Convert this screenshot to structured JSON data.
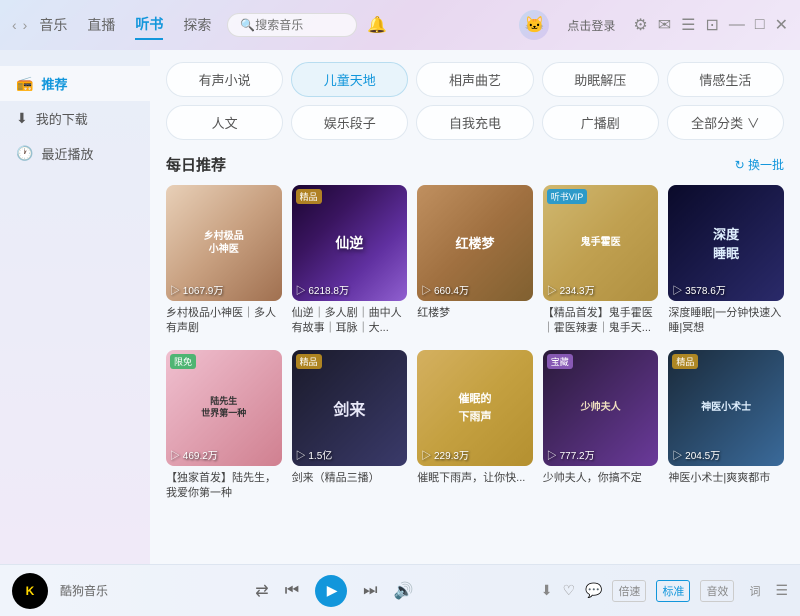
{
  "titleBar": {
    "navArrows": [
      "‹",
      "›"
    ],
    "navItems": [
      {
        "label": "音乐",
        "active": false
      },
      {
        "label": "直播",
        "active": false
      },
      {
        "label": "听书",
        "active": true
      },
      {
        "label": "探索",
        "active": false
      }
    ],
    "searchPlaceholder": "搜索音乐",
    "loginLabel": "点击登录",
    "windowControls": [
      "⚙",
      "✉",
      "☰",
      "⊡",
      "—",
      "□",
      "✕"
    ]
  },
  "sidebar": {
    "items": [
      {
        "label": "推荐",
        "icon": "📻",
        "active": true
      },
      {
        "label": "我的下载",
        "icon": "⬇",
        "active": false
      },
      {
        "label": "最近播放",
        "icon": "🕐",
        "active": false
      }
    ]
  },
  "categories": {
    "row1": [
      {
        "label": "有声小说",
        "active": false
      },
      {
        "label": "儿童天地",
        "active": true
      },
      {
        "label": "相声曲艺",
        "active": false
      },
      {
        "label": "助眠解压",
        "active": false
      },
      {
        "label": "情感生活",
        "active": false
      }
    ],
    "row2": [
      {
        "label": "人文",
        "active": false
      },
      {
        "label": "娱乐段子",
        "active": false
      },
      {
        "label": "自我充电",
        "active": false
      },
      {
        "label": "广播剧",
        "active": false
      },
      {
        "label": "全部分类 ∨",
        "active": false
      }
    ]
  },
  "dailySection": {
    "title": "每日推荐",
    "refreshLabel": "↻ 换一批"
  },
  "cards": {
    "row1": [
      {
        "badge": "",
        "badgeType": "",
        "playCount": "▷ 1067.9万",
        "title": "乡村极品小神医｜多人有声剧",
        "bg": "bg1",
        "overlayText": "乡村极品小神医"
      },
      {
        "badge": "精品",
        "badgeType": "gold",
        "playCount": "▷ 6218.8万",
        "title": "仙逆｜多人剧｜曲中人有故事｜耳脉｜大...",
        "bg": "bg2",
        "overlayText": "仙逆"
      },
      {
        "badge": "",
        "badgeType": "",
        "playCount": "▷ 660.4万",
        "title": "红楼梦",
        "bg": "bg3",
        "overlayText": "红楼梦"
      },
      {
        "badge": "听书VIP",
        "badgeType": "blue",
        "playCount": "▷ 234.3万",
        "title": "【精品首发】鬼手霍医｜霍医辣妻｜鬼手天...",
        "bg": "bg4",
        "overlayText": "鬼手霍医"
      },
      {
        "badge": "",
        "badgeType": "",
        "playCount": "▷ 3578.6万",
        "title": "深度睡眠|一分钟快速入睡|冥想",
        "bg": "bg5",
        "overlayText": "深度睡眠"
      }
    ],
    "row2": [
      {
        "badge": "限免",
        "badgeType": "",
        "playCount": "▷ 469.2万",
        "title": "【独家首发】陆先生，我爱你第一种",
        "bg": "bg6",
        "overlayText": "陆先生，世界第一种"
      },
      {
        "badge": "精品",
        "badgeType": "gold",
        "playCount": "▷ 1.5亿",
        "title": "剑来（精品三播）",
        "bg": "bg7",
        "overlayText": "剑来"
      },
      {
        "badge": "",
        "badgeType": "",
        "playCount": "▷ 229.3万",
        "title": "催眠下雨声，让你快...",
        "bg": "bg8",
        "overlayText": "催眠的下雨声"
      },
      {
        "badge": "宝藏",
        "badgeType": "",
        "playCount": "▷ 777.2万",
        "title": "少帅夫人，你搞不定",
        "bg": "bg9",
        "overlayText": "少帅夫人"
      },
      {
        "badge": "精品",
        "badgeType": "gold",
        "playCount": "▷ 204.5万",
        "title": "神医小术士|爽爽都市",
        "bg": "bg10",
        "overlayText": "神医小术士"
      }
    ]
  },
  "player": {
    "logoText": "K",
    "appName": "酷狗音乐",
    "controls": {
      "loop": "⇄",
      "prev": "⏮",
      "play": "▶",
      "next": "⏭",
      "volume": "🔊"
    },
    "rightControls": {
      "download": "⬇",
      "like": "♡",
      "comment": "💬",
      "speedLabel": "倍速",
      "qualityLabel": "标准",
      "effectLabel": "音效",
      "lyrics": "词",
      "playlist": "☰"
    }
  }
}
